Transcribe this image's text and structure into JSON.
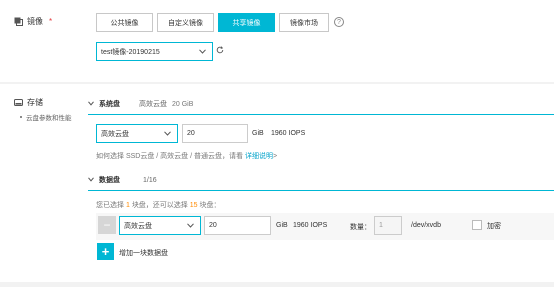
{
  "image": {
    "label": "镜像",
    "required_mark": "*",
    "tabs": [
      {
        "label": "公共镜像"
      },
      {
        "label": "自定义镜像"
      },
      {
        "label": "共享镜像"
      },
      {
        "label": "镜像市场"
      }
    ],
    "active_tab": "共享镜像",
    "help_icon": "?",
    "selected_image": "test镜像-20190215"
  },
  "storage": {
    "label": "存储",
    "subnav_item": "云盘参数和性能",
    "system_disk": {
      "title": "系统盘",
      "summary_type": "高效云盘",
      "summary_size": "20 GiB",
      "type_value": "高效云盘",
      "size_value": "20",
      "unit": "GiB",
      "iops": "1960 IOPS",
      "hint_prefix": "如何选择 SSD云盘 / 高效云盘 / 普通云盘，请看",
      "hint_link": "详细说明",
      "hint_arrow": ">"
    },
    "data_disk": {
      "title": "数据盘",
      "count": "1/16",
      "selection_text_a": "您已选择",
      "selection_selected": "1",
      "selection_text_b": "块盘，还可以选择",
      "selection_remaining": "15",
      "selection_text_c": "块盘：",
      "row": {
        "minus": "−",
        "type_value": "高效云盘",
        "size_value": "20",
        "unit": "GiB",
        "iops": "1960 IOPS",
        "quantity_label": "数量：",
        "quantity_value": "1",
        "device": "/dev/xvdb",
        "encrypt_label": "加密"
      },
      "add_button_icon": "+",
      "add_button_label": "增加一块数据盘"
    }
  },
  "colors": {
    "accent": "#00b7d4",
    "highlight": "#ff8a00",
    "link": "#00a2ca"
  }
}
